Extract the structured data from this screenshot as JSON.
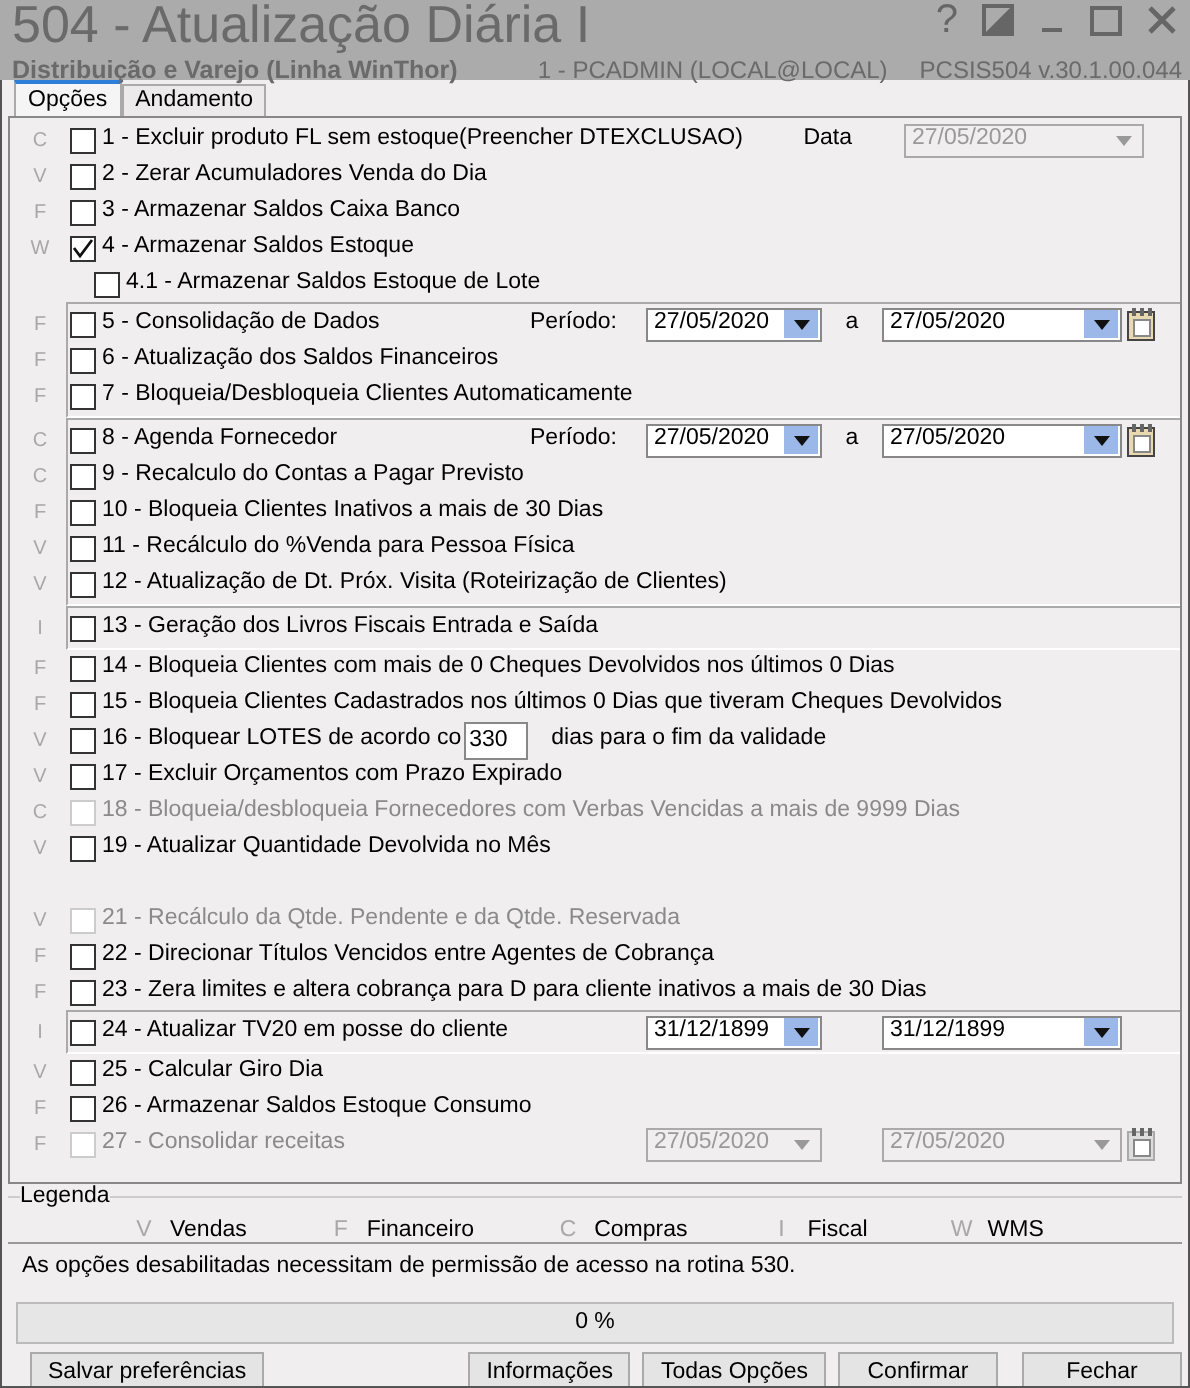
{
  "window": {
    "title": "504 - Atualização Diária I",
    "subtitle": "Distribuição e Varejo (Linha WinThor)",
    "user": "1 - PCADMIN (LOCAL@LOCAL)",
    "program": "PCSIS504  v.30.1.00.044",
    "help": "?"
  },
  "tabs": [
    {
      "label": "Opções",
      "selected": true
    },
    {
      "label": "Andamento",
      "selected": false
    }
  ],
  "sections": [
    {
      "rows": [
        {
          "category": "C",
          "label": "1 - Excluir produto FL sem estoque(Preencher DTEXCLUSAO)",
          "checked": false,
          "disabled": false,
          "date": {
            "label": "Data",
            "value": "27/05/2020",
            "disabled": true
          }
        },
        {
          "category": "V",
          "label": "2 - Zerar Acumuladores Venda do Dia",
          "checked": false,
          "disabled": false
        },
        {
          "category": "F",
          "label": "3 - Armazenar Saldos Caixa Banco",
          "checked": false,
          "disabled": false
        },
        {
          "category": "W",
          "label": "4 - Armazenar Saldos Estoque",
          "checked": true,
          "disabled": false,
          "children": [
            {
              "label": "4.1 - Armazenar Saldos Estoque de Lote",
              "checked": false,
              "disabled": false
            }
          ]
        }
      ]
    },
    {
      "framed": true,
      "rows": [
        {
          "category": "F",
          "label": "5 - Consolidação de Dados",
          "checked": false,
          "disabled": false,
          "period": {
            "label": "Período:",
            "from": "27/05/2020",
            "separator": "a",
            "to": "27/05/2020",
            "calendar": true
          }
        },
        {
          "category": "F",
          "label": "6 - Atualização dos Saldos Financeiros",
          "checked": false,
          "disabled": false
        },
        {
          "category": "F",
          "label": "7 - Bloqueia/Desbloqueia Clientes Automaticamente",
          "checked": false,
          "disabled": false
        }
      ]
    },
    {
      "framed": true,
      "rows": [
        {
          "category": "C",
          "label": "8 - Agenda Fornecedor",
          "checked": false,
          "disabled": false,
          "period": {
            "label": "Período:",
            "from": "27/05/2020",
            "separator": "a",
            "to": "27/05/2020",
            "calendar": true
          }
        },
        {
          "category": "C",
          "label": "9 - Recalculo do Contas a Pagar Previsto",
          "checked": false,
          "disabled": false
        },
        {
          "category": "F",
          "label": "10 - Bloqueia Clientes Inativos a mais de 30 Dias",
          "checked": false,
          "disabled": false
        },
        {
          "category": "V",
          "label": "11 - Recálculo do %Venda para Pessoa Física",
          "checked": false,
          "disabled": false
        },
        {
          "category": "V",
          "label": "12 - Atualização de Dt. Próx. Visita (Roteirização de Clientes)",
          "checked": false,
          "disabled": false
        }
      ]
    },
    {
      "framed": true,
      "rows": [
        {
          "category": "I",
          "label": "13 - Geração dos Livros Fiscais Entrada e Saída",
          "checked": false,
          "disabled": false
        }
      ]
    },
    {
      "rows": [
        {
          "category": "F",
          "label": "14 - Bloqueia Clientes com mais de 0 Cheques Devolvidos nos últimos 0  Dias",
          "checked": false,
          "disabled": false
        },
        {
          "category": "F",
          "label": "15 - Bloqueia Clientes Cadastrados nos últimos 0 Dias que tiveram Cheques Devolvidos",
          "checked": false,
          "disabled": false
        },
        {
          "category": "V",
          "label": "16 - Bloquear LOTES de acordo co",
          "checked": false,
          "disabled": false,
          "number": "330",
          "label_after": "dias para o fim da validade"
        },
        {
          "category": "V",
          "label": "17 - Excluir Orçamentos com Prazo Expirado",
          "checked": false,
          "disabled": false
        },
        {
          "category": "C",
          "label": "18 - Bloqueia/desbloqueia Fornecedores com Verbas Vencidas a mais de 9999 Dias",
          "checked": false,
          "disabled": true
        },
        {
          "category": "V",
          "label": "19 - Atualizar Quantidade Devolvida no Mês",
          "checked": false,
          "disabled": false
        }
      ]
    },
    {
      "gap": true,
      "rows": [
        {
          "category": "V",
          "label": "21 - Recálculo da Qtde. Pendente e da Qtde. Reservada",
          "checked": false,
          "disabled": true
        },
        {
          "category": "F",
          "label": "22 - Direcionar Títulos Vencidos entre Agentes de Cobrança",
          "checked": false,
          "disabled": false
        },
        {
          "category": "F",
          "label": "23 - Zera limites e altera cobrança para D  para cliente inativos a mais de 30 Dias",
          "checked": false,
          "disabled": false
        }
      ]
    },
    {
      "framed": true,
      "rows": [
        {
          "category": "I",
          "label": "24 - Atualizar TV20 em posse do cliente",
          "checked": false,
          "disabled": false,
          "period": {
            "from": "31/12/1899",
            "to": "31/12/1899",
            "calendar": false
          }
        }
      ]
    },
    {
      "rows": [
        {
          "category": "V",
          "label": "25 - Calcular Giro Dia",
          "checked": false,
          "disabled": false
        },
        {
          "category": "F",
          "label": "26 - Armazenar Saldos Estoque Consumo",
          "checked": false,
          "disabled": false
        },
        {
          "category": "F",
          "label": "27 - Consolidar receitas",
          "checked": false,
          "disabled": true,
          "period": {
            "from": "27/05/2020",
            "to": "27/05/2020",
            "calendar": true
          }
        }
      ]
    }
  ],
  "legend": {
    "title": "Legenda",
    "items": [
      {
        "letter": "V",
        "label": "Vendas"
      },
      {
        "letter": "F",
        "label": "Financeiro"
      },
      {
        "letter": "C",
        "label": "Compras"
      },
      {
        "letter": "I",
        "label": "Fiscal"
      },
      {
        "letter": "W",
        "label": "WMS"
      }
    ]
  },
  "message": "As opções desabilitadas necessitam de permissão de acesso na rotina 530.",
  "progress": {
    "level": 0,
    "reading": "0 %"
  },
  "buttons": [
    {
      "label": "Salvar preferências",
      "kind": "left"
    },
    {
      "label": "Informações",
      "kind": "right"
    },
    {
      "label": "Todas Opções",
      "kind": "right"
    },
    {
      "label": "Confirmar",
      "kind": "right"
    },
    {
      "label": "Fechar",
      "kind": "right"
    }
  ]
}
